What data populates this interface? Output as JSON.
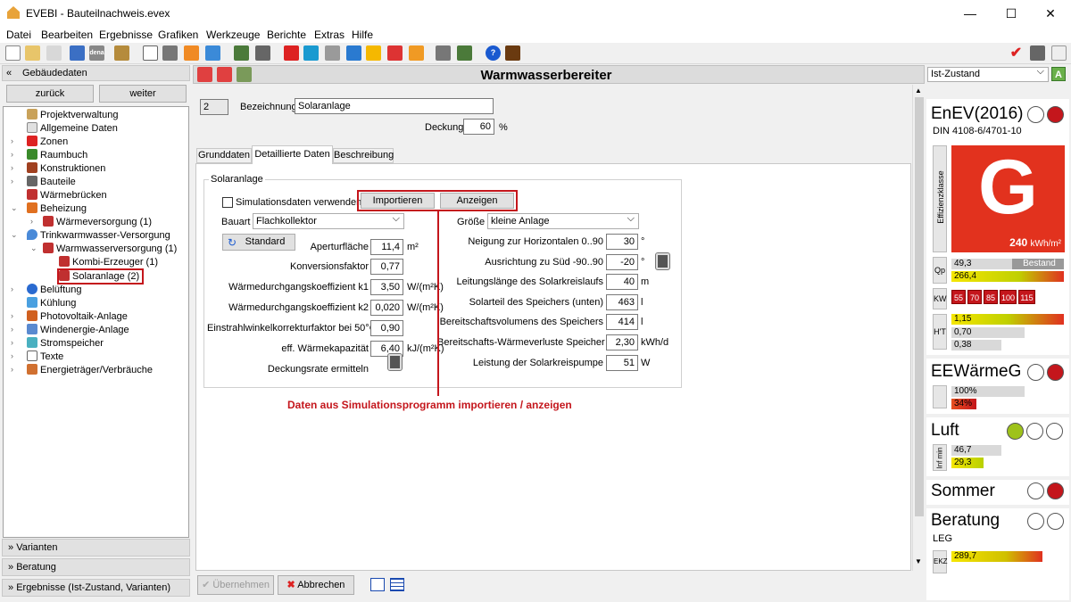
{
  "window": {
    "title": "EVEBI - Bauteilnachweis.evex",
    "min": "—",
    "max": "☐",
    "close": "✕"
  },
  "menu": [
    "Datei",
    "Bearbeiten",
    "Ergebnisse",
    "Grafiken",
    "Werkzeuge",
    "Berichte",
    "Extras",
    "Hilfe"
  ],
  "left": {
    "header": "Gebäudedaten",
    "back": "zurück",
    "forward": "weiter",
    "tree": [
      "Projektverwaltung",
      "Allgemeine Daten",
      "Zonen",
      "Raumbuch",
      "Konstruktionen",
      "Bauteile",
      "Wärmebrücken",
      "Beheizung",
      "Wärmeversorgung (1)",
      "Trinkwarmwasser-Versorgung",
      "Warmwasserversorgung (1)",
      "Kombi-Erzeuger (1)",
      "Solaranlage (2)",
      "Belüftung",
      "Kühlung",
      "Photovoltaik-Anlage",
      "Windenergie-Anlage",
      "Stromspeicher",
      "Texte",
      "Energieträger/Verbräuche"
    ],
    "footer": [
      "Varianten",
      "Beratung",
      "Ergebnisse (Ist-Zustand, Varianten)"
    ]
  },
  "main": {
    "title": "Warmwasserbereiter",
    "number": "2",
    "bezeichnung_label": "Bezeichnung",
    "bezeichnung": "Solaranlage",
    "deckung_label": "Deckung",
    "deckung": "60",
    "deckung_unit": "%",
    "tabs": [
      "Grunddaten",
      "Detaillierte Daten",
      "Beschreibung"
    ],
    "group": "Solaranlage",
    "sim_label": "Simulationsdaten verwenden",
    "import": "Importieren",
    "show": "Anzeigen",
    "bauart_label": "Bauart",
    "bauart": "Flachkollektor",
    "groesse_label": "Größe",
    "groesse": "kleine Anlage",
    "standard": "Standard",
    "left_fields": [
      {
        "label": "Aperturfläche",
        "value": "11,4",
        "unit": "m²"
      },
      {
        "label": "Konversionsfaktor",
        "value": "0,77",
        "unit": ""
      },
      {
        "label": "Wärmedurchgangskoeffizient k1",
        "value": "3,50",
        "unit": "W/(m²K)"
      },
      {
        "label": "Wärmedurchgangskoeffizient k2",
        "value": "0,020",
        "unit": "W/(m²K)"
      },
      {
        "label": "Einstrahlwinkelkorrekturfaktor bei 50°C",
        "value": "0,90",
        "unit": ""
      },
      {
        "label": "eff. Wärmekapazität",
        "value": "6,40",
        "unit": "kJ/(m²K)"
      },
      {
        "label": "Deckungsrate ermitteln",
        "value": "",
        "unit": ""
      }
    ],
    "right_fields": [
      {
        "label": "Neigung zur Horizontalen 0..90",
        "value": "30",
        "unit": "°"
      },
      {
        "label": "Ausrichtung zu Süd -90..90",
        "value": "-20",
        "unit": "°"
      },
      {
        "label": "Leitungslänge des Solarkreislaufs",
        "value": "40",
        "unit": "m"
      },
      {
        "label": "Solarteil des Speichers (unten)",
        "value": "463",
        "unit": "l"
      },
      {
        "label": "Bereitschaftsvolumens des Speichers",
        "value": "414",
        "unit": "l"
      },
      {
        "label": "Bereitschafts-Wärmeverluste Speicher",
        "value": "2,30",
        "unit": "kWh/d"
      },
      {
        "label": "Leistung der Solarkreispumpe",
        "value": "51",
        "unit": "W"
      }
    ],
    "annotation": "Daten aus Simulationsprogramm importieren / anzeigen",
    "accept": "Übernehmen",
    "cancel": "Abbrechen"
  },
  "right": {
    "state": "Ist-Zustand",
    "enev": "EnEV(2016)",
    "din": "DIN 4108-6/4701-10",
    "effizienz": "Effizienzklasse",
    "grade": "G",
    "grade_value": "240",
    "grade_unit": "kWh/m²",
    "qp_label": "Qp",
    "qp": [
      "49,3",
      "266,4"
    ],
    "bestand": "Bestand",
    "kw_label": "KW",
    "kw": [
      "55",
      "70",
      "85",
      "100",
      "115"
    ],
    "ht_label": "H'T",
    "ht": [
      "1,15",
      "0,70",
      "0,38"
    ],
    "ee": "EEWärmeG",
    "ee_vals": [
      "100%",
      "34%"
    ],
    "luft": "Luft",
    "inf_label": "Inf min",
    "luft_vals": [
      "46,7",
      "29,3"
    ],
    "sommer": "Sommer",
    "beratung": "Beratung",
    "leg": "LEG",
    "ekz_label": "EKZ",
    "ekz": "289,7"
  }
}
